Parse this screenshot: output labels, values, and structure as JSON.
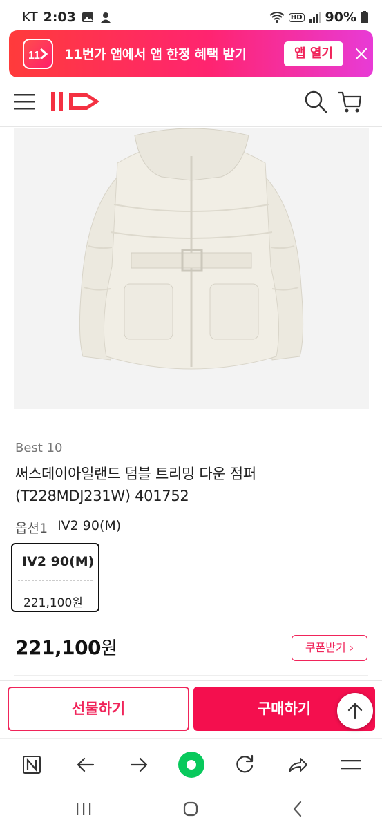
{
  "status_bar": {
    "carrier": "KT",
    "time": "2:03",
    "hd": "HD",
    "battery": "90%"
  },
  "promo": {
    "text": "11번가 앱에서 앱 한정 혜택 받기",
    "open_label": "앱 열기",
    "accent": "#f0245a"
  },
  "product": {
    "badge": "Best 10",
    "title_line1": "써스데이아일랜드 덤블 트리밍 다운 점퍼",
    "title_line2": "(T228MDJ231W) 401752",
    "option_label": "옵션1",
    "option_value": "IV2 90(M)",
    "option_card": {
      "name": "IV2 90(M)",
      "price": "221,100원"
    },
    "price_number": "221,100",
    "price_unit": "원",
    "coupon_label": "쿠폰받기 ›"
  },
  "actions": {
    "gift_label": "선물하기",
    "buy_label": "구매하기",
    "buy_color": "#f40f4e"
  },
  "browser": {
    "icons": [
      "naver-icon",
      "back-icon",
      "forward-icon",
      "green-dot-icon",
      "refresh-icon",
      "share-icon",
      "menu-icon"
    ]
  },
  "system_nav": {
    "icons": [
      "recents-icon",
      "home-icon",
      "back-icon"
    ]
  }
}
